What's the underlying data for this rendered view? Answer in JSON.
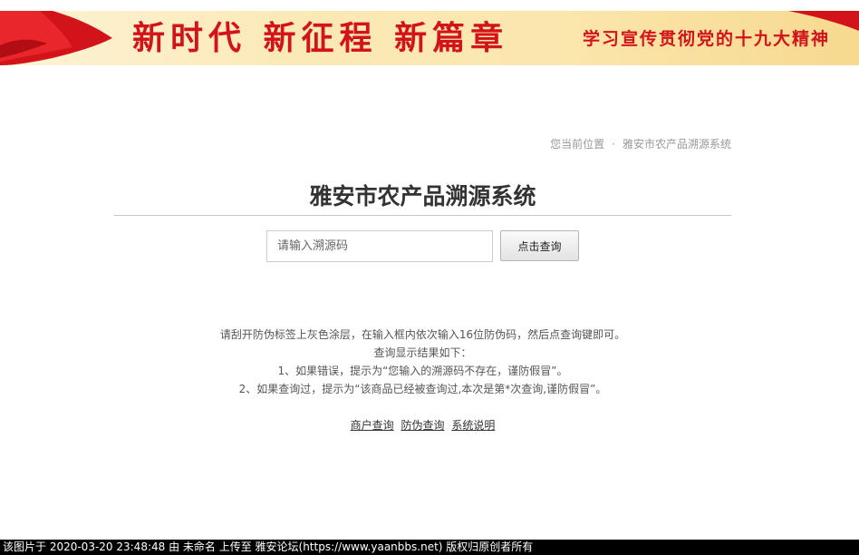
{
  "banner": {
    "title": "新时代 新征程 新篇章",
    "subtitle": "学习宣传贯彻党的十九大精神"
  },
  "breadcrumb": {
    "current_label": "您当前位置",
    "separator": "·",
    "page": "雅安市农产品溯源系统"
  },
  "page_title": "雅安市农产品溯源系统",
  "search": {
    "placeholder": "请输入溯源码",
    "value": "",
    "button_label": "点击查询"
  },
  "instructions": [
    "请刮开防伪标签上灰色涂层，在输入框内依次输入16位防伪码，然后点查询键即可。",
    "查询显示结果如下：",
    "1、如果错误，提示为“您输入的溯源码不存在，谨防假冒”。",
    "2、如果查询过，提示为“该商品已经被查询过,本次是第*次查询,谨防假冒”。"
  ],
  "links": [
    {
      "label": "商户查询"
    },
    {
      "label": "防伪查询"
    },
    {
      "label": "系统说明"
    }
  ],
  "caption": "该图片于 2020-03-20 23:48:48 由 未命名 上传至 雅安论坛(https://www.yaanbbs.net) 版权归原创者所有",
  "colors": {
    "banner_red": "#d3131a",
    "banner_gold": "#fbe6ad",
    "title_text": "#333333",
    "muted_text": "#999999"
  }
}
